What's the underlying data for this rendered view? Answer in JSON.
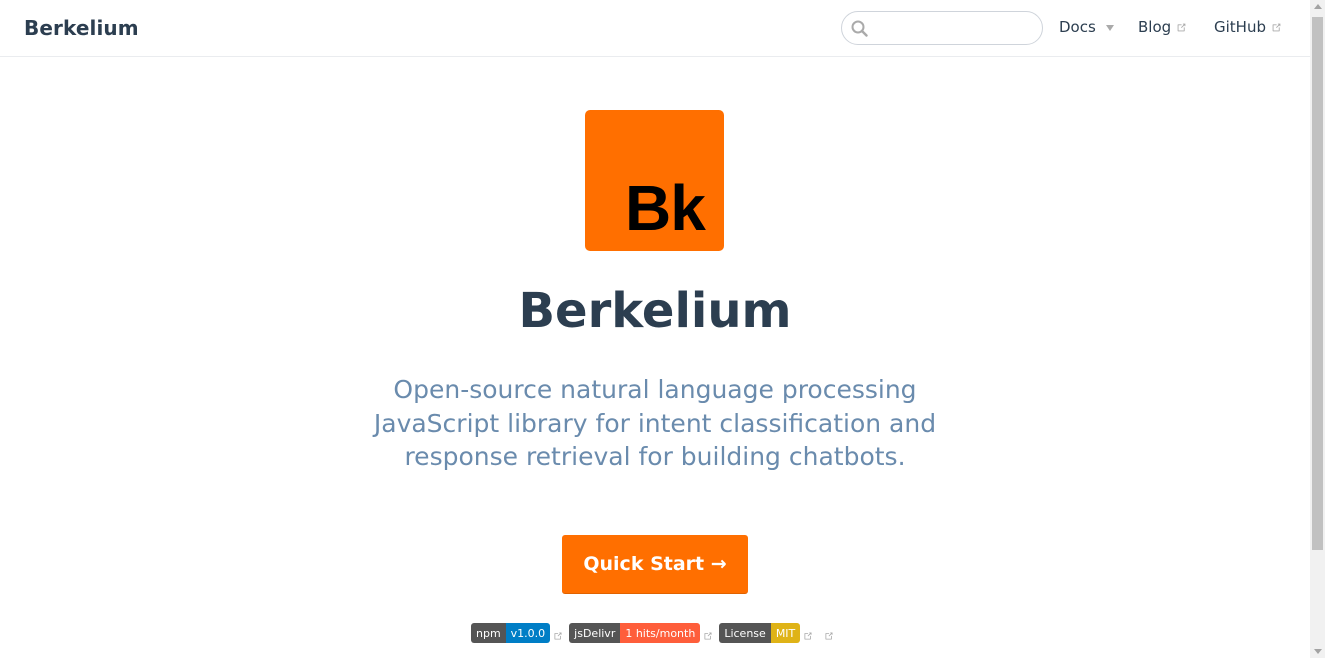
{
  "navbar": {
    "site_name": "Berkelium",
    "search": {
      "value": "",
      "placeholder": ""
    },
    "links": [
      {
        "label": "Docs",
        "has_dropdown": true
      },
      {
        "label": "Blog",
        "external": true
      },
      {
        "label": "GitHub",
        "external": true
      }
    ]
  },
  "hero": {
    "logo_text": "Bk",
    "title": "Berkelium",
    "description": "Open-source natural language processing JavaScript library for intent classification and response retrieval for building chatbots.",
    "cta_label": "Quick Start →"
  },
  "badges": [
    {
      "left": "npm",
      "right": "v1.0.0",
      "color": "#007ec6"
    },
    {
      "left": "jsDelivr",
      "right": "1 hits/month",
      "color": "#fe5e3b"
    },
    {
      "left": "License",
      "right": "MIT",
      "color": "#dfb317"
    }
  ],
  "colors": {
    "brand": "#ff6f00",
    "text": "#2c3e50",
    "description": "#6a8bad"
  }
}
